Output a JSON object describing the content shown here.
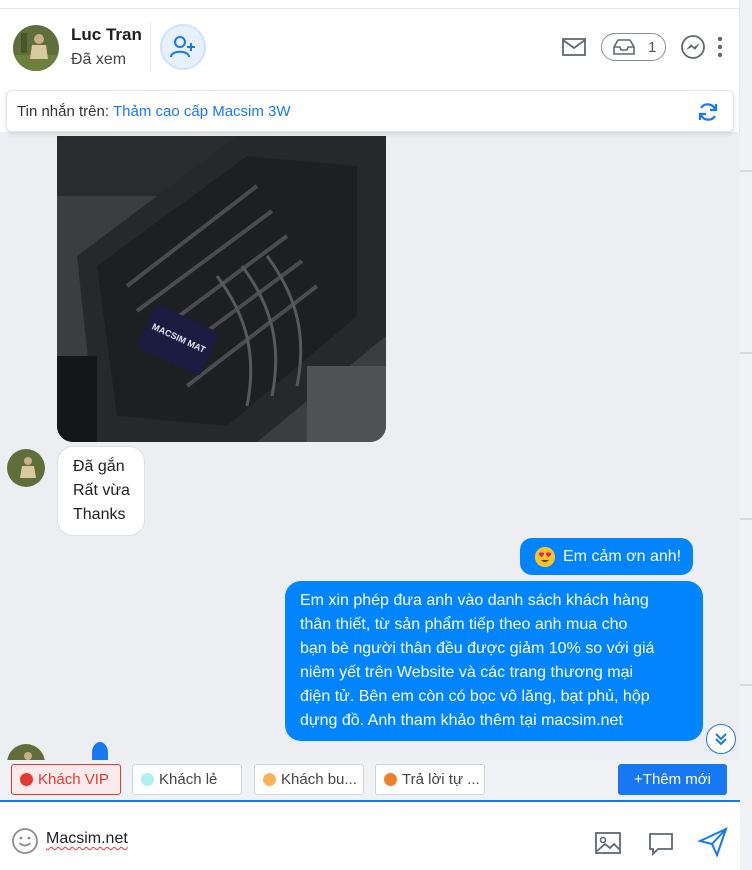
{
  "header": {
    "contact_name": "Luc Tran",
    "status": "Đã xem",
    "inbox_count": "1"
  },
  "context_bar": {
    "label": "Tin nhắn trên:",
    "product": "Thảm cao cấp Macsim 3W"
  },
  "photo": {
    "brand_label": "MACSIM MAT"
  },
  "messages": {
    "incoming": [
      "Đã gắn",
      "Rất vừa",
      "Thanks"
    ],
    "outgoing_1": "Em cảm ơn anh!",
    "outgoing_2_lines": [
      "Em xin phép đưa anh vào danh sách khách hàng",
      "thân thiết, từ sản phẩm tiếp theo anh mua cho",
      "bạn bè người thân đều được giảm 10% so với giá",
      "niêm yết trên Website và các trang thương mại",
      "điện tử. Bên em còn có bọc vô lăng, bạt phủ, hộp",
      "dựng đồ. Anh tham khảo thêm tại macsim.net"
    ]
  },
  "tags": [
    {
      "label": "Khách VIP",
      "color": "#e53935"
    },
    {
      "label": "Khách lẻ",
      "color": "#aef0f0"
    },
    {
      "label": "Khách bu...",
      "color": "#f9b35a"
    },
    {
      "label": "Trả lời tự ...",
      "color": "#f07f2a"
    }
  ],
  "add_tag_label": "+Thêm mới",
  "composer": {
    "value": "Macsim.net"
  },
  "colors": {
    "accent": "#1877f2",
    "outgoing_bubble": "#0084ff",
    "chat_bg": "#eceef2"
  }
}
